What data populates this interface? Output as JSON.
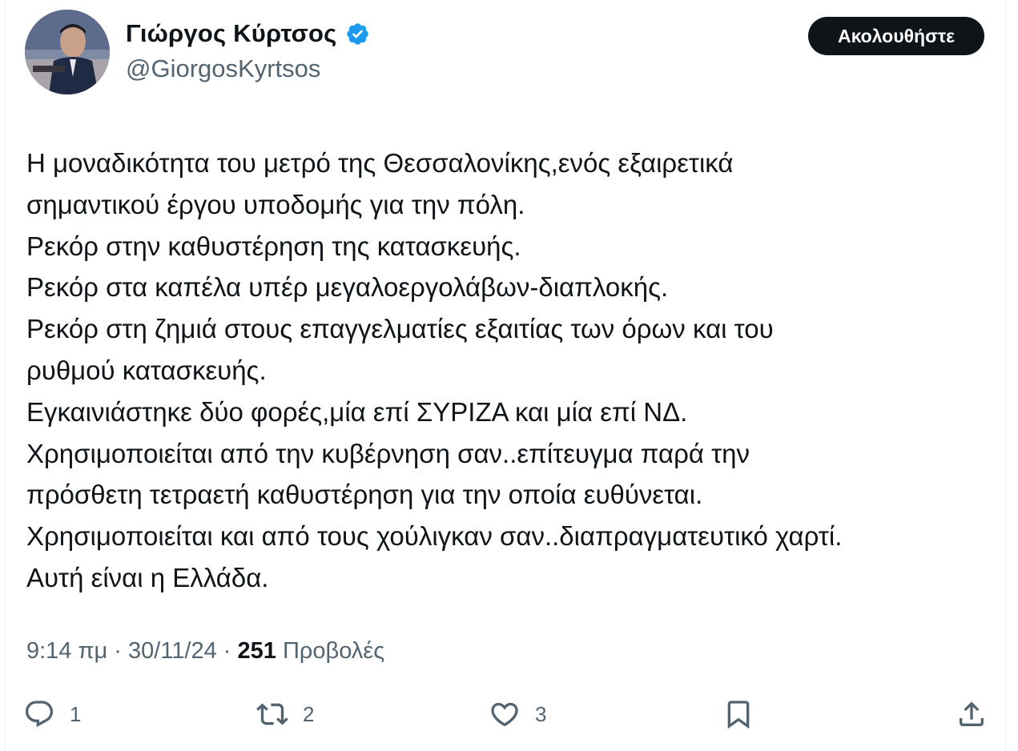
{
  "header": {
    "display_name": "Γιώργος Κύρτσος",
    "handle": "@GiorgosKyrtsos",
    "follow_label": "Ακολουθήστε",
    "verified_icon": "verified-badge-icon",
    "accent_color": "#1d9bf0"
  },
  "tweet": {
    "lines": [
      "Η μοναδικότητα του μετρό της Θεσσαλονίκης,ενός εξαιρετικά",
      "σημαντικού έργου υποδομής για την πόλη.",
      "Ρεκόρ στην καθυστέρηση της κατασκευής.",
      "Ρεκόρ στα καπέλα υπέρ μεγαλοεργολάβων-διαπλοκής.",
      "Ρεκόρ στη ζημιά στους επαγγελματίες εξαιτίας των όρων και του",
      "ρυθμού κατασκευής.",
      "Εγκαινιάστηκε δύο φορές,μία επί ΣΥΡΙΖΑ και μία επί ΝΔ.",
      "Χρησιμοποιείται από την κυβέρνηση σαν..επίτευγμα παρά την",
      "πρόσθετη τετραετή καθυστέρηση για την οποία ευθύνεται.",
      "Χρησιμοποιείται και από τους χούλιγκαν σαν..διαπραγματευτικό χαρτί.",
      "Αυτή είναι η Ελλάδα."
    ]
  },
  "meta": {
    "time": "9:14 πμ",
    "separator": " · ",
    "date": "30/11/24",
    "views_count": "251",
    "views_label": "Προβολές"
  },
  "actions": {
    "replies": "1",
    "reposts": "2",
    "likes": "3"
  }
}
